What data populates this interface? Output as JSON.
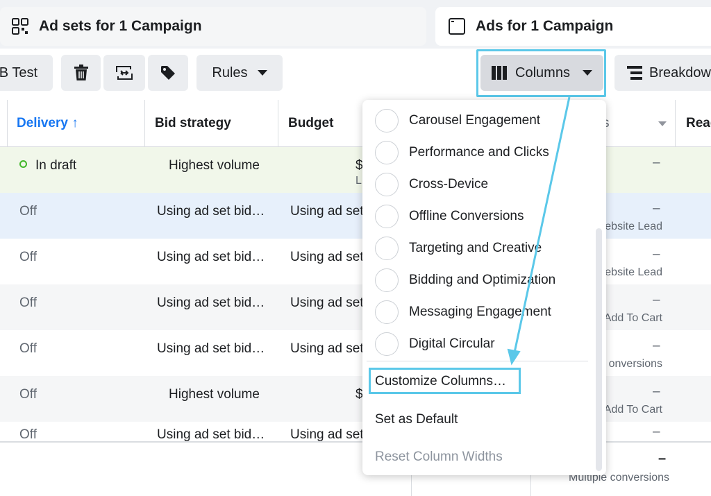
{
  "tabs": {
    "adsets_title": "Ad sets for 1 Campaign",
    "ads_title": "Ads for 1 Campaign"
  },
  "toolbar": {
    "ab_test_label": "B Test",
    "rules_label": "Rules",
    "columns_label": "Columns",
    "breakdown_label": "Breakdow"
  },
  "table": {
    "headers": {
      "delivery": "Delivery ↑",
      "bid_strategy": "Bid strategy",
      "budget": "Budget",
      "results_partial": "s",
      "reach_partial": "Read"
    },
    "rows": [
      {
        "delivery": "In draft",
        "bid": "Highest volume",
        "budget": "$",
        "budget_sub": "L",
        "result": "–",
        "result_sub": ""
      },
      {
        "delivery": "Off",
        "bid": "Using ad set bid…",
        "budget": "Using ad set",
        "budget_sub": "",
        "result": "–",
        "result_sub": "ebsite Lead"
      },
      {
        "delivery": "Off",
        "bid": "Using ad set bid…",
        "budget": "Using ad set",
        "budget_sub": "",
        "result": "–",
        "result_sub": "ebsite Lead"
      },
      {
        "delivery": "Off",
        "bid": "Using ad set bid…",
        "budget": "Using ad set",
        "budget_sub": "",
        "result": "–",
        "result_sub": "Add To Cart"
      },
      {
        "delivery": "Off",
        "bid": "Using ad set bid…",
        "budget": "Using ad set",
        "budget_sub": "",
        "result": "–",
        "result_sub": "onversions"
      },
      {
        "delivery": "Off",
        "bid": "Highest volume",
        "budget": "$",
        "budget_sub": "",
        "result": "–",
        "result_sub": "Add To Cart"
      },
      {
        "delivery": "Off",
        "bid": "Using ad set bid…",
        "budget": "Using ad set",
        "budget_sub": "",
        "result": "–",
        "result_sub": ""
      }
    ],
    "footer": {
      "result": "–",
      "result_sub": "Multiple conversions"
    }
  },
  "dropdown": {
    "presets": [
      "Carousel Engagement",
      "Performance and Clicks",
      "Cross-Device",
      "Offline Conversions",
      "Targeting and Creative",
      "Bidding and Optimization",
      "Messaging Engagement",
      "Digital Circular"
    ],
    "customize_label": "Customize Columns…",
    "set_default_label": "Set as Default",
    "reset_widths_label": "Reset Column Widths"
  },
  "colors": {
    "highlight": "#5bc8e9",
    "delivery_header": "#1877f2",
    "draft_row": "#f1f7ea",
    "selected_row": "#e7f0fb",
    "draft_dot": "#42b72a"
  }
}
